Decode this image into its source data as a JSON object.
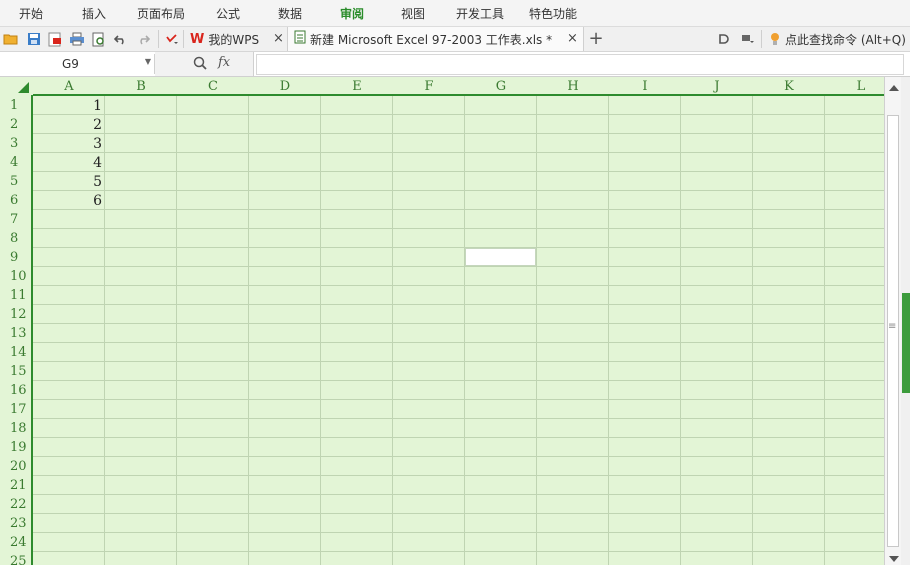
{
  "menu": {
    "tabs": [
      "开始",
      "插入",
      "页面布局",
      "公式",
      "数据",
      "审阅",
      "视图",
      "开发工具",
      "特色功能"
    ],
    "active_tab": "审阅"
  },
  "toolbar": {
    "tabs": [
      {
        "icon": "wps-logo-icon",
        "label": "我的WPS"
      },
      {
        "icon": "spreadsheet-file-icon",
        "label": "新建 Microsoft Excel 97-2003 工作表.xls *"
      }
    ],
    "command_search": "点此查找命令 (Alt+Q)",
    "colors": {
      "active_tab": "#2a8c2a",
      "wps_logo": "#d9251c",
      "lightbulb": "#f0a030"
    }
  },
  "formula_bar": {
    "name_box": "G9",
    "fx_label": "fx",
    "formula": ""
  },
  "sheet": {
    "columns": [
      "A",
      "B",
      "C",
      "D",
      "E",
      "F",
      "G",
      "H",
      "I",
      "J",
      "K",
      "L"
    ],
    "rows": [
      "1",
      "2",
      "3",
      "4",
      "5",
      "6",
      "7",
      "8",
      "9",
      "10",
      "11",
      "12",
      "13",
      "14",
      "15",
      "16",
      "17",
      "18",
      "19",
      "20",
      "21",
      "22",
      "23",
      "24",
      "25"
    ],
    "column_A_values": [
      "1",
      "2",
      "3",
      "4",
      "5",
      "6"
    ],
    "selected_cell": "G9",
    "colors": {
      "grid_background": "#e3f5d6",
      "header_text": "#3a7a30",
      "accent": "#2e8b2e"
    }
  }
}
